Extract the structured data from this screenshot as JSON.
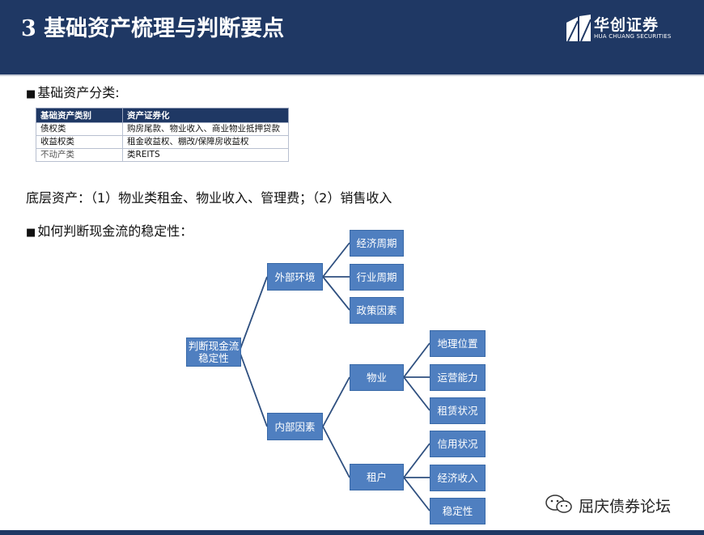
{
  "header": {
    "title": "3 基础资产梳理与判断要点",
    "logo_cn": "华创证券",
    "logo_en": "HUA CHUANG SECURITIES"
  },
  "section1": {
    "bullet": "■",
    "label": "基础资产分类:"
  },
  "table": {
    "headers": [
      "基础资产类别",
      "资产证券化"
    ],
    "rows": [
      [
        "债权类",
        "购房尾款、物业收入、商业物业抵押贷款"
      ],
      [
        "收益权类",
        "租金收益权、棚改/保障房收益权"
      ],
      [
        "不动产类",
        "类REITS"
      ]
    ]
  },
  "underlying_text": "底层资产：（1）物业类租金、物业收入、管理费；（2）销售收入",
  "section2": {
    "bullet": "■",
    "label": "如何判断现金流的稳定性："
  },
  "tree": {
    "root": "判断现金流稳定性",
    "external": {
      "label": "外部环境",
      "children": [
        "经济周期",
        "行业周期",
        "政策因素"
      ]
    },
    "internal": {
      "label": "内部因素",
      "property": {
        "label": "物业",
        "children": [
          "地理位置",
          "运营能力",
          "租赁状况"
        ]
      },
      "tenant": {
        "label": "租户",
        "children": [
          "信用状况",
          "经济收入",
          "稳定性"
        ]
      }
    }
  },
  "watermark": "屈庆债券论坛",
  "colors": {
    "header_bg": "#1f3864",
    "node_fill": "#4f7fc0",
    "connector": "#2e4f7f"
  }
}
